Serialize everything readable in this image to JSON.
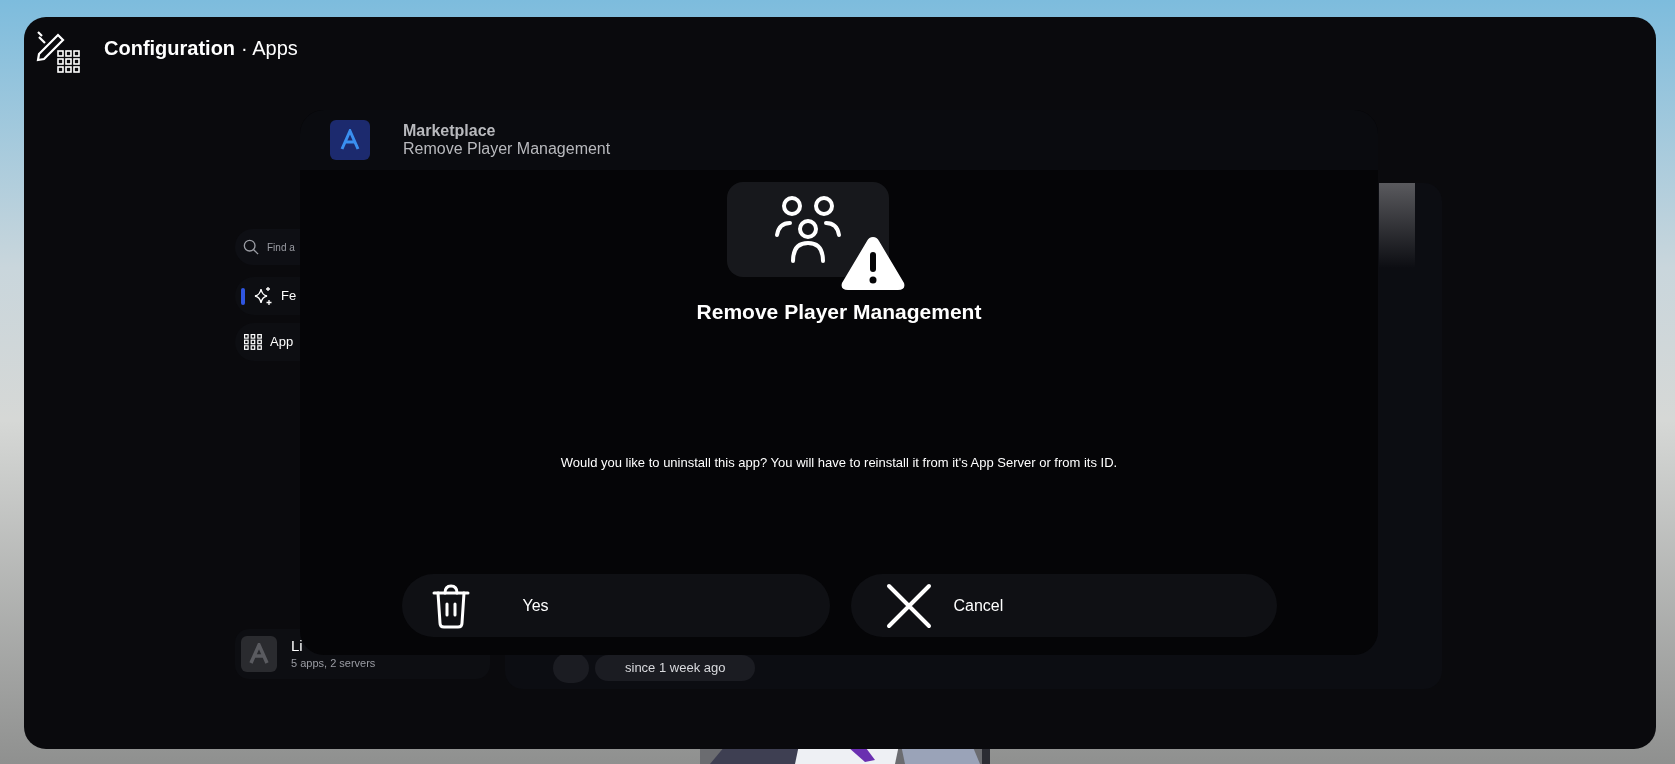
{
  "app_bar": {
    "title": "Configuration",
    "section": "· Apps"
  },
  "sidebar": {
    "search": {
      "placeholder": "Find a"
    },
    "items": [
      {
        "kind": "featured",
        "label": "Fe",
        "selected": true
      },
      {
        "kind": "apps",
        "label": "App",
        "selected": false
      }
    ],
    "library": {
      "title": "Li",
      "subtitle": "5 apps, 2 servers"
    }
  },
  "main": {
    "status_chip": "since 1 week ago"
  },
  "dialog": {
    "source": "Marketplace",
    "subtitle": "Remove Player Management",
    "title": "Remove Player Management",
    "message": "Would you like to uninstall this app? You will have to reinstall it from it's App Server or from its ID.",
    "buttons": [
      {
        "kind": "confirm",
        "label": "Yes"
      },
      {
        "kind": "cancel",
        "label": "Cancel"
      }
    ]
  }
}
